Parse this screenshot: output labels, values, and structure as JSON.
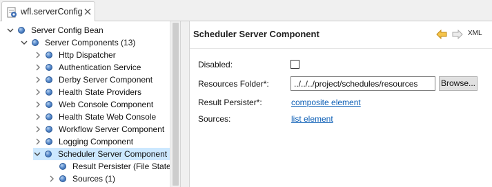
{
  "tab": {
    "title": "wfl.serverConfig",
    "icon": "config-file-icon"
  },
  "tree": {
    "items": [
      {
        "label": "Server Config Bean",
        "level": 0,
        "toggle": "expanded"
      },
      {
        "label": "Server Components (13)",
        "level": 1,
        "toggle": "expanded"
      },
      {
        "label": "Http Dispatcher",
        "level": 2,
        "toggle": "collapsed"
      },
      {
        "label": "Authentication Service",
        "level": 2,
        "toggle": "collapsed"
      },
      {
        "label": "Derby Server Component",
        "level": 2,
        "toggle": "collapsed"
      },
      {
        "label": "Health State Providers",
        "level": 2,
        "toggle": "collapsed"
      },
      {
        "label": "Web Console Component",
        "level": 2,
        "toggle": "collapsed"
      },
      {
        "label": "Health State Web Console",
        "level": 2,
        "toggle": "collapsed"
      },
      {
        "label": "Workflow Server Component",
        "level": 2,
        "toggle": "collapsed"
      },
      {
        "label": "Logging Component",
        "level": 2,
        "toggle": "collapsed"
      },
      {
        "label": "Scheduler Server Component",
        "level": 2,
        "toggle": "expanded",
        "selected": true
      },
      {
        "label": "Result Persister (File State F",
        "level": 3,
        "toggle": "none"
      },
      {
        "label": "Sources (1)",
        "level": 3,
        "toggle": "collapsed"
      }
    ]
  },
  "details": {
    "title": "Scheduler Server Component",
    "xml_label": "XML",
    "fields": {
      "disabled_label": "Disabled:",
      "disabled_checked": false,
      "resources_folder_label": "Resources Folder*:",
      "resources_folder_value": "../../../project/schedules/resources",
      "browse_label": "Browse...",
      "result_persister_label": "Result Persister*:",
      "result_persister_link": "composite element",
      "sources_label": "Sources:",
      "sources_link": "list element"
    }
  },
  "colors": {
    "link": "#0d5fb6",
    "selection": "#cce8ff",
    "nav_arrow": "#d99a1a"
  }
}
